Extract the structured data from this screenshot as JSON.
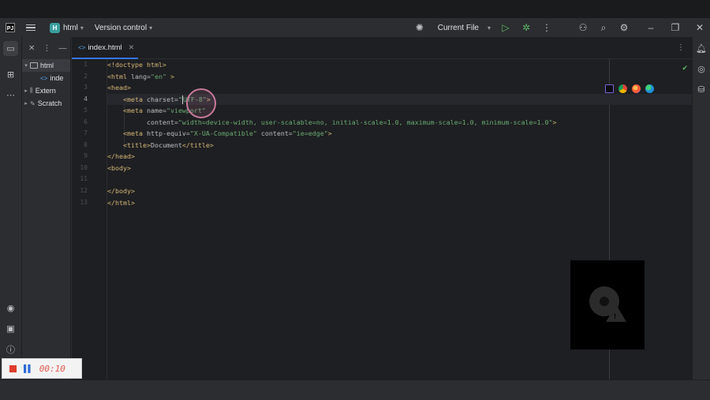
{
  "titlebar": {
    "project_badge": "H",
    "project_name": "html",
    "version_control": "Version control",
    "run_config": "Current File"
  },
  "project_panel": {
    "tree": [
      {
        "label": "html",
        "kind": "folder",
        "expanded": true
      },
      {
        "label": "inde",
        "kind": "file"
      },
      {
        "label": "Extern",
        "kind": "library"
      },
      {
        "label": "Scratch",
        "kind": "scratch"
      }
    ]
  },
  "editor": {
    "tab": {
      "label": "index.html"
    },
    "current_line": 4,
    "line_numbers": [
      "1",
      "2",
      "3",
      "4",
      "5",
      "6",
      "7",
      "8",
      "9",
      "10",
      "11",
      "12",
      "13"
    ],
    "code": {
      "l1": {
        "tag": "<!doctype html>"
      },
      "l2": {
        "open": "<html ",
        "attr": "lang=",
        "val": "\"en\"",
        "close": " >"
      },
      "l3": {
        "tag": "<head>"
      },
      "l4": {
        "open": "<meta ",
        "attr": "charset=",
        "val_a": "\"",
        "val_b": "UTF-8\"",
        "close": ">"
      },
      "l5": {
        "open": "<meta ",
        "attr": "name=",
        "val": "\"viewport\""
      },
      "l6": {
        "attr": "content=",
        "val": "\"width=device-width, user-scalable=no, initial-scale=1.0, maximum-scale=1.0, minimum-scale=1.0\"",
        "close": ">"
      },
      "l7": {
        "open": "<meta ",
        "attr1": "http-equiv=",
        "val1": "\"X-UA-Compatible\" ",
        "attr2": "content=",
        "val2": "\"ie=edge\"",
        "close": ">"
      },
      "l8": {
        "open": "<title>",
        "text": "Document",
        "close": "</title>"
      },
      "l9": {
        "tag": "</head>"
      },
      "l10": {
        "tag": "<body>"
      },
      "l11": {
        "tag": ""
      },
      "l12": {
        "tag": "</body>"
      },
      "l13": {
        "tag": "</html>"
      }
    }
  },
  "recorder": {
    "time": "00:10"
  },
  "colors": {
    "accent": "#3574f0",
    "tag": "#d5b778",
    "string": "#6aab73",
    "success": "#5fb865",
    "record": "#e03c2c"
  },
  "icons": {
    "browsers": [
      "intellij-icon",
      "chrome-icon",
      "firefox-icon",
      "edge-icon"
    ]
  }
}
